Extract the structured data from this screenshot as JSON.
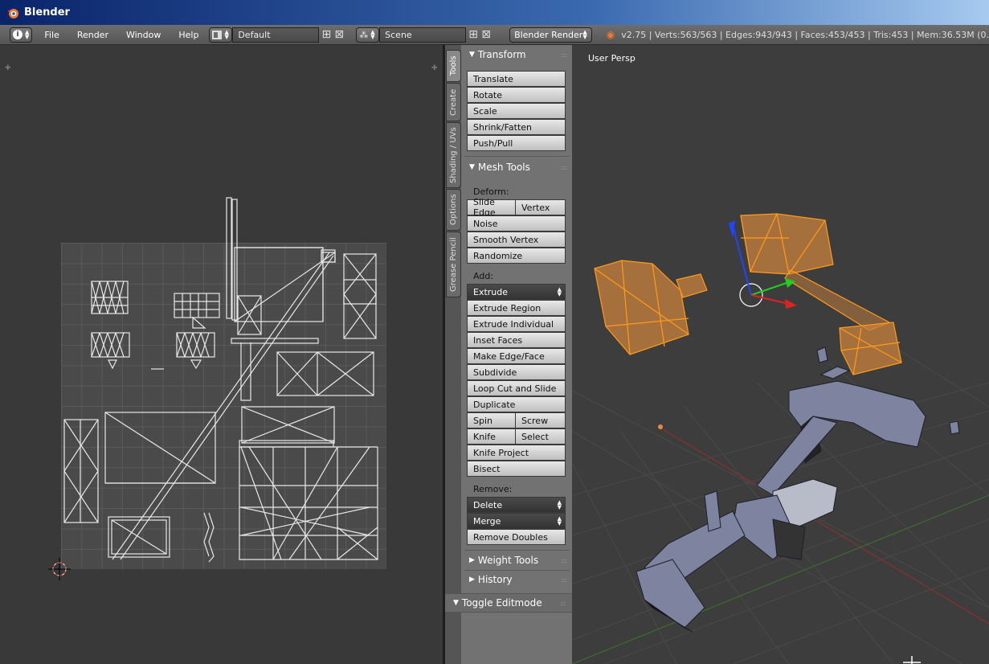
{
  "window": {
    "title": "Blender"
  },
  "header": {
    "menus": [
      "File",
      "Render",
      "Window",
      "Help"
    ],
    "screen_layout": "Default",
    "scene": "Scene",
    "render_engine": "Blender Render",
    "stats": "v2.75 | Verts:563/563 | Edges:943/943 | Faces:453/453 | Tris:453 | Mem:36.53M (0."
  },
  "tabs": [
    "Tools",
    "Create",
    "Shading / UVs",
    "Options",
    "Grease Pencil"
  ],
  "tool_shelf": {
    "transform": {
      "title": "Transform",
      "buttons": [
        "Translate",
        "Rotate",
        "Scale",
        "Shrink/Fatten",
        "Push/Pull"
      ]
    },
    "mesh_tools": {
      "title": "Mesh Tools",
      "deform_label": "Deform:",
      "slide_edge": "Slide Edge",
      "vertex": "Vertex",
      "noise": "Noise",
      "smooth_vertex": "Smooth Vertex",
      "randomize": "Randomize",
      "add_label": "Add:",
      "extrude": "Extrude",
      "extrude_region": "Extrude Region",
      "extrude_individual": "Extrude Individual",
      "inset_faces": "Inset Faces",
      "make_edge_face": "Make Edge/Face",
      "subdivide": "Subdivide",
      "loop_cut": "Loop Cut and Slide",
      "duplicate": "Duplicate",
      "spin": "Spin",
      "screw": "Screw",
      "knife": "Knife",
      "select": "Select",
      "knife_project": "Knife Project",
      "bisect": "Bisect",
      "remove_label": "Remove:",
      "delete": "Delete",
      "merge": "Merge",
      "remove_doubles": "Remove Doubles"
    },
    "weight_tools": {
      "title": "Weight Tools"
    },
    "history": {
      "title": "History"
    },
    "toggle_editmode": "Toggle Editmode"
  },
  "viewport": {
    "label": "User Persp"
  }
}
